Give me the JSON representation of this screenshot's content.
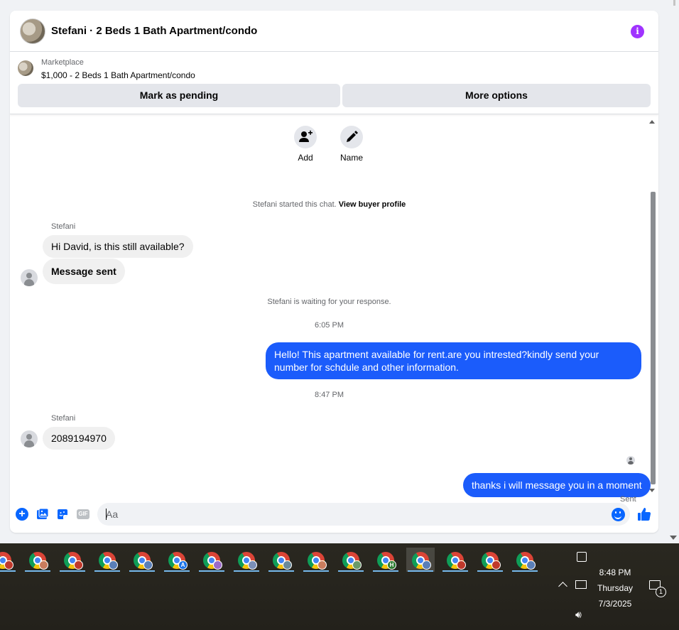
{
  "header": {
    "title": "Stefani · 2 Beds 1 Bath Apartment/condo"
  },
  "listing": {
    "source": "Marketplace",
    "title": "$1,000 - 2 Beds 1 Bath Apartment/condo",
    "mark_pending_label": "Mark as pending",
    "more_options_label": "More options"
  },
  "actions": {
    "add_label": "Add",
    "name_label": "Name"
  },
  "conversation": {
    "started_text": "Stefani started this chat.",
    "view_profile_label": "View buyer profile",
    "sender_name_1": "Stefani",
    "message_1": "Hi David, is this still available?",
    "message_2": "Message sent",
    "waiting_text": "Stefani is waiting for your response.",
    "time_1": "6:05 PM",
    "outgoing_1": "Hello! This apartment available for rent.are you intrested?kindly send your number for schdule and other information.",
    "time_2": "8:47 PM",
    "sender_name_2": "Stefani",
    "message_3": "2089194970",
    "outgoing_2": "thanks i will message you in a moment",
    "status": "Sent"
  },
  "composer": {
    "placeholder": "Aa",
    "gif_label": "GIF"
  },
  "colors": {
    "accent": "#1b5cfb",
    "info": "#a033ff",
    "button_bg": "#e4e6eb"
  },
  "taskbar": {
    "apps": [
      {
        "badge": "",
        "badge_color": "#c0392b"
      },
      {
        "badge": "",
        "badge_color": "#c97c5d"
      },
      {
        "badge": "",
        "badge_color": "#c0392b"
      },
      {
        "badge": "",
        "badge_color": "#5a7fb8"
      },
      {
        "badge": "",
        "badge_color": "#5a7fb8"
      },
      {
        "badge": "A",
        "badge_color": "#1a73e8"
      },
      {
        "badge": "",
        "badge_color": "#9b6bc8"
      },
      {
        "badge": "",
        "badge_color": "#7a8fb8"
      },
      {
        "badge": "",
        "badge_color": "#6a8a9a"
      },
      {
        "badge": "",
        "badge_color": "#c97c5d"
      },
      {
        "badge": "",
        "badge_color": "#6a9a6a"
      },
      {
        "badge": "H",
        "badge_color": "#2e7d32"
      },
      {
        "badge": "",
        "badge_color": "#5a7fb8"
      },
      {
        "badge": "",
        "badge_color": "#c0392b"
      },
      {
        "badge": "",
        "badge_color": "#c0392b"
      },
      {
        "badge": "",
        "badge_color": "#5a7fb8"
      }
    ],
    "active_index": 12,
    "time": "8:48 PM",
    "day": "Thursday",
    "date": "7/3/2025",
    "notification_count": "1"
  }
}
